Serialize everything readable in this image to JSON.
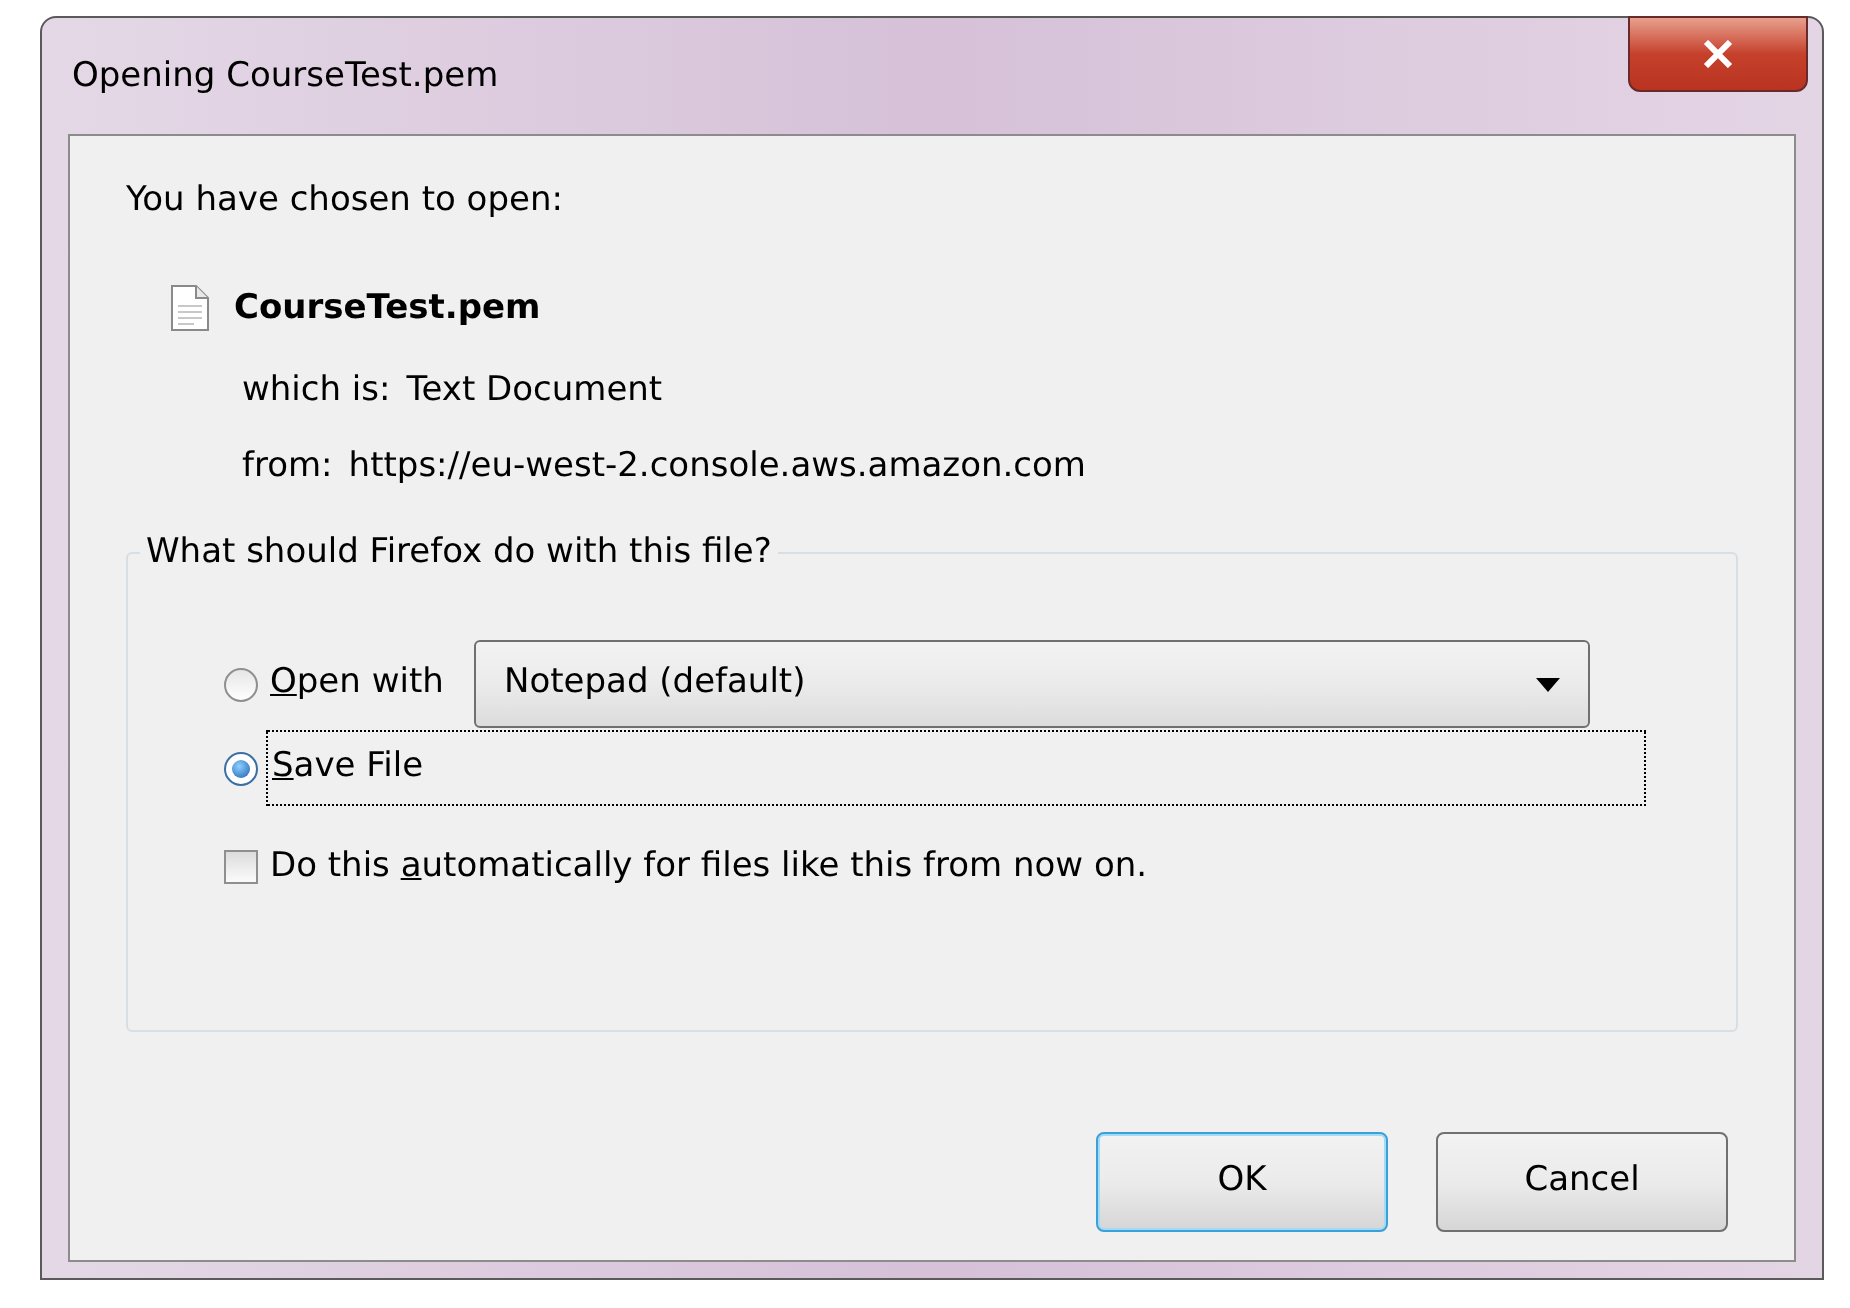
{
  "window": {
    "title": "Opening CourseTest.pem"
  },
  "intro": "You have chosen to open:",
  "file": {
    "name": "CourseTest.pem",
    "type_label": "which is:",
    "type": "Text Document",
    "from_label": "from:",
    "from": "https://eu-west-2.console.aws.amazon.com"
  },
  "group": {
    "legend": "What should Firefox do with this file?",
    "options": [
      {
        "kind": "open",
        "key": "O",
        "rest": "pen with",
        "selected": false,
        "app": "Notepad (default)"
      },
      {
        "kind": "save",
        "key": "S",
        "rest": "ave File",
        "selected": true
      }
    ],
    "remember": {
      "before": "Do this ",
      "key": "a",
      "rest": "utomatically for files like this from now on.",
      "checked": false
    }
  },
  "buttons": [
    {
      "label": "OK",
      "default": true
    },
    {
      "label": "Cancel",
      "default": false
    }
  ]
}
